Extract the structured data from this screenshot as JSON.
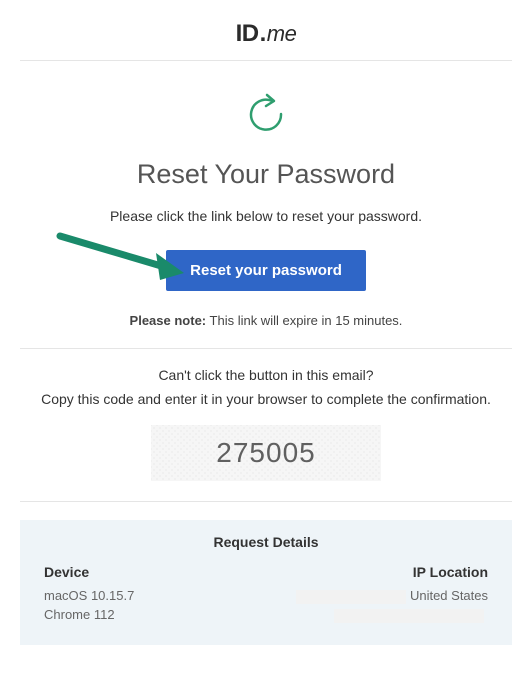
{
  "logo": {
    "id_text": "ID",
    "dot": ".",
    "me": "me"
  },
  "title": "Reset Your Password",
  "subtitle": "Please click the link below to reset your password.",
  "cta_label": "Reset your password",
  "note_label": "Please note:",
  "note_text": " This link will expire in 15 minutes.",
  "alt_title": "Can't click the button in this email?",
  "alt_sub": "Copy this code and enter it in your browser to complete the confirmation.",
  "code": "275005",
  "details": {
    "title": "Request Details",
    "device_header": "Device",
    "ip_header": "IP Location",
    "device_os": "macOS 10.15.7",
    "device_browser": "Chrome 112",
    "ip_country": "United States"
  },
  "colors": {
    "accent": "#2f66c7",
    "green": "#2f9e6f"
  }
}
